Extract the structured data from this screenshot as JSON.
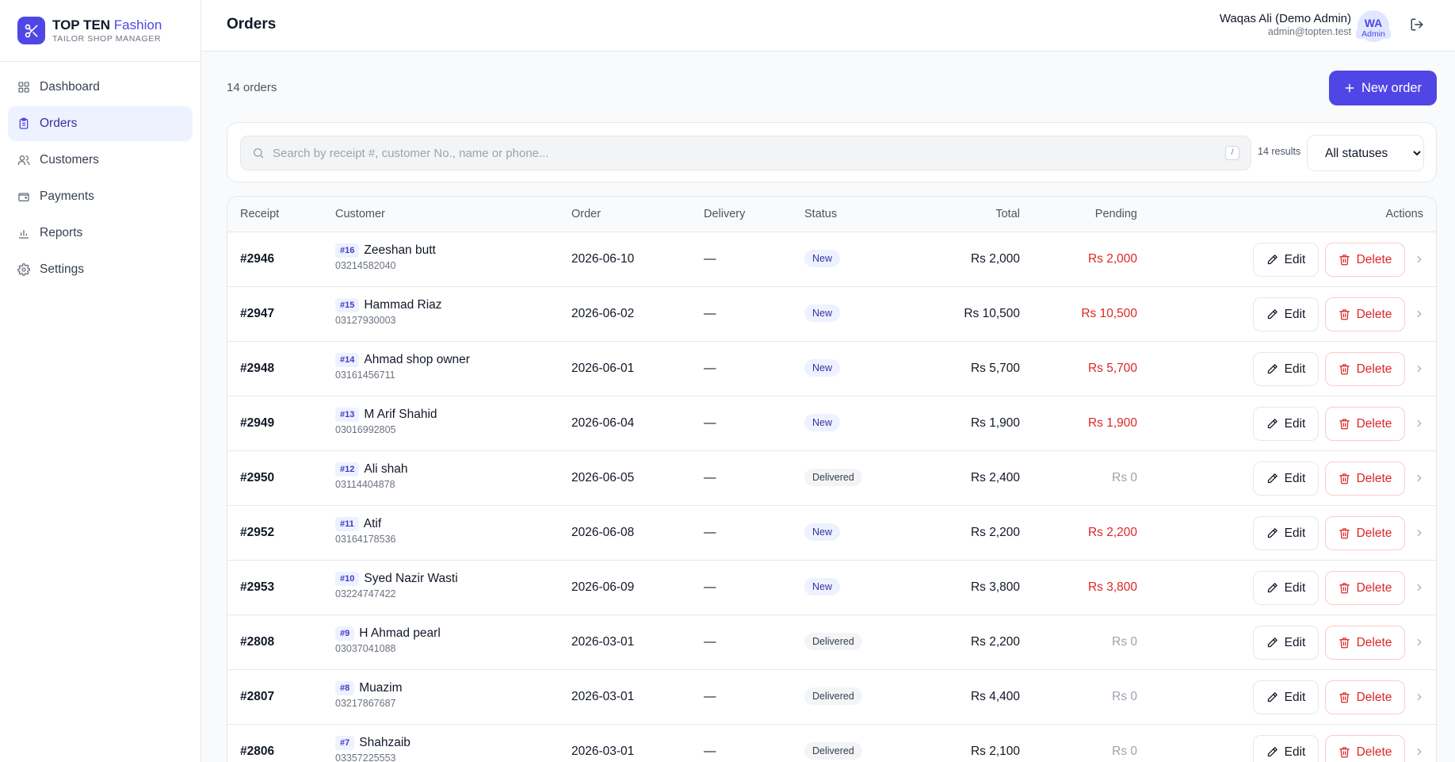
{
  "brand": {
    "title_main": "TOP TEN",
    "title_accent": "Fashion",
    "subtitle": "TAILOR SHOP MANAGER"
  },
  "nav": [
    {
      "label": "Dashboard",
      "icon": "dashboard-icon"
    },
    {
      "label": "Orders",
      "icon": "clipboard-icon",
      "active": true
    },
    {
      "label": "Customers",
      "icon": "users-icon"
    },
    {
      "label": "Payments",
      "icon": "wallet-icon"
    },
    {
      "label": "Reports",
      "icon": "bar-chart-icon"
    },
    {
      "label": "Settings",
      "icon": "gear-icon"
    }
  ],
  "header": {
    "title": "Orders",
    "user_name": "Waqas Ali (Demo Admin)",
    "user_email": "admin@topten.test",
    "avatar_initials": "WA",
    "avatar_role": "Admin"
  },
  "toolbar": {
    "count_label": "14 orders",
    "new_order_label": "New order"
  },
  "filters": {
    "search_placeholder": "Search by receipt #, customer No., name or phone...",
    "shortcut": "/",
    "results_label": "14 results",
    "status_selected": "All statuses"
  },
  "table": {
    "headers": {
      "receipt": "Receipt",
      "customer": "Customer",
      "order": "Order",
      "delivery": "Delivery",
      "status": "Status",
      "total": "Total",
      "pending": "Pending",
      "actions": "Actions"
    },
    "edit_label": "Edit",
    "delete_label": "Delete",
    "rows": [
      {
        "receipt": "#2946",
        "cust_no": "#16",
        "name": "Zeeshan butt",
        "phone": "03214582040",
        "order": "2026-06-10",
        "delivery": "—",
        "status": "New",
        "total": "Rs 2,000",
        "pending": "Rs 2,000"
      },
      {
        "receipt": "#2947",
        "cust_no": "#15",
        "name": "Hammad Riaz",
        "phone": "03127930003",
        "order": "2026-06-02",
        "delivery": "—",
        "status": "New",
        "total": "Rs 10,500",
        "pending": "Rs 10,500"
      },
      {
        "receipt": "#2948",
        "cust_no": "#14",
        "name": "Ahmad shop owner",
        "phone": "03161456711",
        "order": "2026-06-01",
        "delivery": "—",
        "status": "New",
        "total": "Rs 5,700",
        "pending": "Rs 5,700"
      },
      {
        "receipt": "#2949",
        "cust_no": "#13",
        "name": "M Arif Shahid",
        "phone": "03016992805",
        "order": "2026-06-04",
        "delivery": "—",
        "status": "New",
        "total": "Rs 1,900",
        "pending": "Rs 1,900"
      },
      {
        "receipt": "#2950",
        "cust_no": "#12",
        "name": "Ali shah",
        "phone": "03114404878",
        "order": "2026-06-05",
        "delivery": "—",
        "status": "Delivered",
        "total": "Rs 2,400",
        "pending": "Rs 0"
      },
      {
        "receipt": "#2952",
        "cust_no": "#11",
        "name": "Atif",
        "phone": "03164178536",
        "order": "2026-06-08",
        "delivery": "—",
        "status": "New",
        "total": "Rs 2,200",
        "pending": "Rs 2,200"
      },
      {
        "receipt": "#2953",
        "cust_no": "#10",
        "name": "Syed Nazir Wasti",
        "phone": "03224747422",
        "order": "2026-06-09",
        "delivery": "—",
        "status": "New",
        "total": "Rs 3,800",
        "pending": "Rs 3,800"
      },
      {
        "receipt": "#2808",
        "cust_no": "#9",
        "name": "H Ahmad pearl",
        "phone": "03037041088",
        "order": "2026-03-01",
        "delivery": "—",
        "status": "Delivered",
        "total": "Rs 2,200",
        "pending": "Rs 0"
      },
      {
        "receipt": "#2807",
        "cust_no": "#8",
        "name": "Muazim",
        "phone": "03217867687",
        "order": "2026-03-01",
        "delivery": "—",
        "status": "Delivered",
        "total": "Rs 4,400",
        "pending": "Rs 0"
      },
      {
        "receipt": "#2806",
        "cust_no": "#7",
        "name": "Shahzaib",
        "phone": "03357225553",
        "order": "2026-03-01",
        "delivery": "—",
        "status": "Delivered",
        "total": "Rs 2,100",
        "pending": "Rs 0"
      }
    ]
  },
  "colors": {
    "accent": "#4f46e5",
    "danger": "#dc2626",
    "muted": "#9ca3af"
  }
}
